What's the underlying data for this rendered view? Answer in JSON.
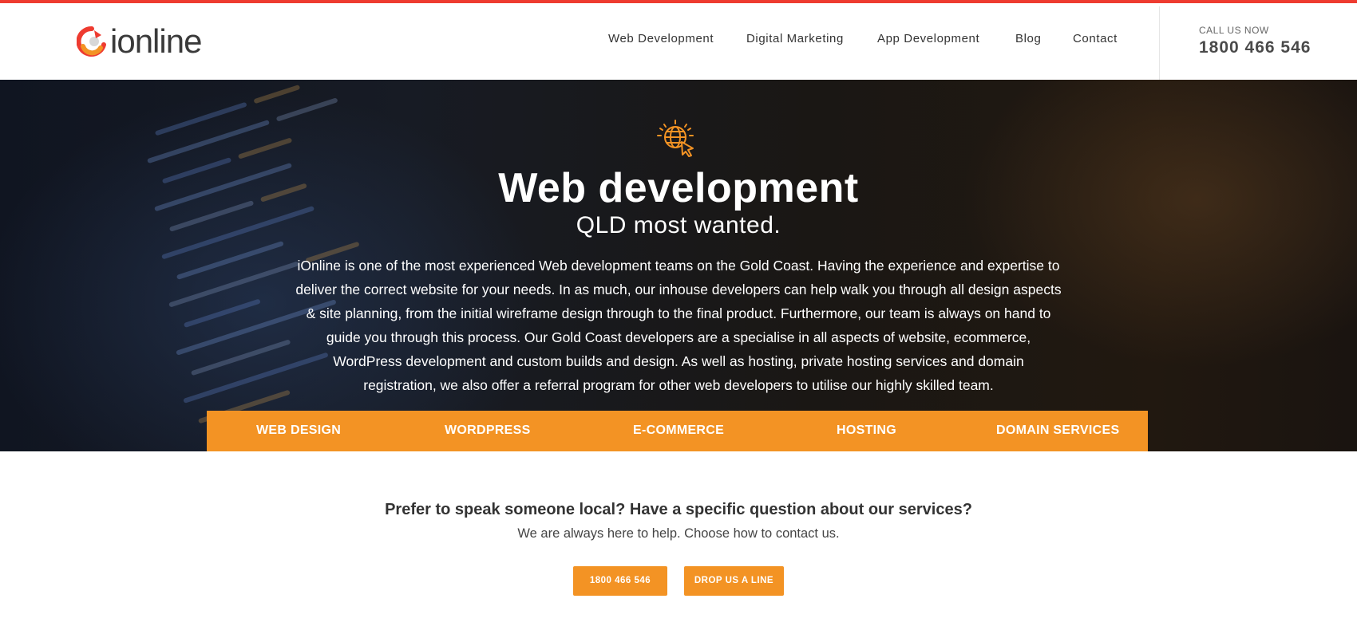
{
  "header": {
    "logo_text": "ionline",
    "nav": [
      {
        "label": "Web Development"
      },
      {
        "label": "Digital Marketing"
      },
      {
        "label": "App Development"
      },
      {
        "label": "Blog"
      },
      {
        "label": "Contact"
      }
    ],
    "call_label": "CALL US NOW",
    "call_number": "1800 466 546"
  },
  "hero": {
    "icon": "globe-cursor-icon",
    "title": "Web development",
    "subtitle": "QLD most wanted.",
    "body": "iOnline is one of the most experienced Web development teams on the Gold Coast. Having the experience and expertise to deliver the correct website for your needs. In as much, our inhouse developers can help walk you through all design aspects & site planning, from the initial wireframe design through to the final product. Furthermore, our team is always on hand to guide you through this process. Our Gold Coast developers are a specialise in all aspects of website, ecommerce, WordPress development and custom builds and design.  As well as hosting, private hosting services and domain registration, we also offer a referral program for other web developers to utilise our highly skilled team."
  },
  "services": [
    {
      "label": "WEB DESIGN"
    },
    {
      "label": "WORDPRESS"
    },
    {
      "label": "E-COMMERCE"
    },
    {
      "label": "HOSTING"
    },
    {
      "label": "DOMAIN SERVICES"
    }
  ],
  "contact": {
    "heading": "Prefer to speak someone local?  Have a specific question about our services?",
    "subheading": "We are always here to help. Choose how to contact us.",
    "phone_button": "1800 466 546",
    "drop_button": "DROP US A LINE"
  },
  "colors": {
    "accent_orange": "#f39324",
    "top_strip_red": "#ee3b30",
    "text_dark": "#333333"
  }
}
